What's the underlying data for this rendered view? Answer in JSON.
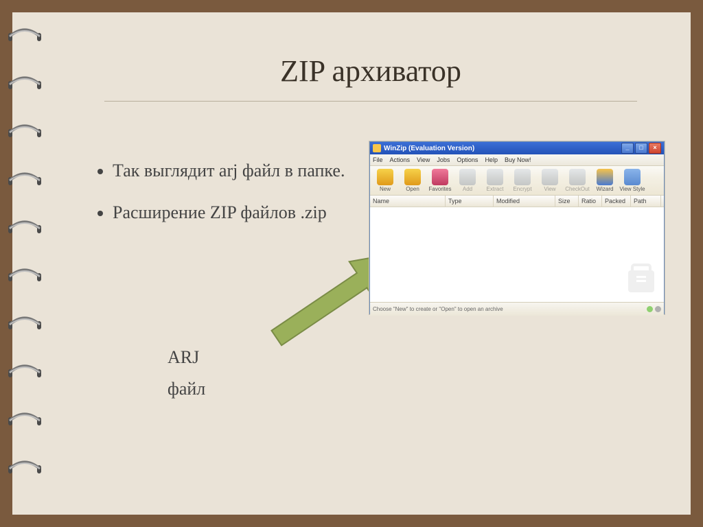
{
  "slide": {
    "title": "ZIP архиватор",
    "bullets": [
      "Так выглядит arj файл в папке.",
      "Расширение ZIP файлов .zip"
    ],
    "label1": "ARJ",
    "label2": "файл"
  },
  "winzip": {
    "title": "WinZip (Evaluation Version)",
    "btn_min": "_",
    "btn_max": "□",
    "btn_close": "×",
    "menu": [
      "File",
      "Actions",
      "View",
      "Jobs",
      "Options",
      "Help",
      "Buy Now!"
    ],
    "toolbar": [
      {
        "label": "New",
        "color": "linear-gradient(#f6d24a,#e09a1a)",
        "dis": false
      },
      {
        "label": "Open",
        "color": "linear-gradient(#f6d24a,#e09a1a)",
        "dis": false
      },
      {
        "label": "Favorites",
        "color": "linear-gradient(#f07a9a,#c03a60)",
        "dis": false
      },
      {
        "label": "Add",
        "color": "linear-gradient(#cfd6df,#9aa3b0)",
        "dis": true
      },
      {
        "label": "Extract",
        "color": "linear-gradient(#cfd6df,#9aa3b0)",
        "dis": true
      },
      {
        "label": "Encrypt",
        "color": "linear-gradient(#cfd6df,#9aa3b0)",
        "dis": true
      },
      {
        "label": "View",
        "color": "linear-gradient(#cfd6df,#9aa3b0)",
        "dis": true
      },
      {
        "label": "CheckOut",
        "color": "linear-gradient(#cfd6df,#9aa3b0)",
        "dis": true
      },
      {
        "label": "Wizard",
        "color": "linear-gradient(#f6c24a,#4a7ad0)",
        "dis": false
      },
      {
        "label": "View Style",
        "color": "linear-gradient(#8ab4ea,#5a8ad0)",
        "dis": false
      }
    ],
    "columns": [
      {
        "label": "Name",
        "w": 110
      },
      {
        "label": "Type",
        "w": 70
      },
      {
        "label": "Modified",
        "w": 90
      },
      {
        "label": "Size",
        "w": 34
      },
      {
        "label": "Ratio",
        "w": 34
      },
      {
        "label": "Packed",
        "w": 42
      },
      {
        "label": "Path",
        "w": 44
      }
    ],
    "status": "Choose \"New\" to create or \"Open\" to open an archive",
    "leds": [
      "#8fd070",
      "#b0b0b0"
    ]
  }
}
